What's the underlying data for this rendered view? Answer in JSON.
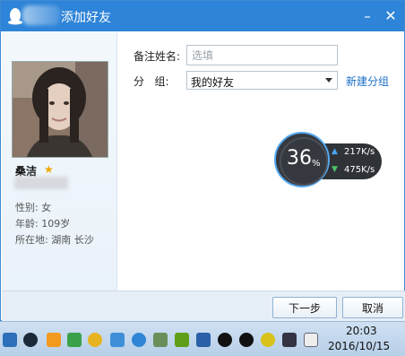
{
  "window": {
    "title": "添加好友",
    "minimize_glyph": "–",
    "close_glyph": "✕"
  },
  "profile": {
    "name": "桑洁",
    "gender_label": "性别: 女",
    "age_label": "年龄: 109岁",
    "location_label": "所在地: 湖南  长沙"
  },
  "form": {
    "remark_label": "备注姓名:",
    "remark_placeholder": "选填",
    "group_label": "分   组:",
    "group_value": "我的好友",
    "new_group_link": "新建分组"
  },
  "speed_widget": {
    "percent": "36",
    "percent_sign": "%",
    "upload": "217K/s",
    "download": "475K/s"
  },
  "footer": {
    "next_button": "下一步",
    "cancel_button": "取消"
  },
  "taskbar": {
    "time": "20:03",
    "date": "2016/10/15",
    "tray_icons": [
      "shield-icon",
      "steam-icon",
      "tool-icon",
      "security-icon",
      "browser-icon",
      "box-icon",
      "network-icon",
      "people-icon",
      "nvidia-icon",
      "app-icon",
      "qq-icon",
      "qq-icon",
      "wechat-icon",
      "display-icon",
      "volume-icon"
    ]
  },
  "colors": {
    "title_bar": "#2e84d8",
    "link": "#1c6fc7"
  }
}
